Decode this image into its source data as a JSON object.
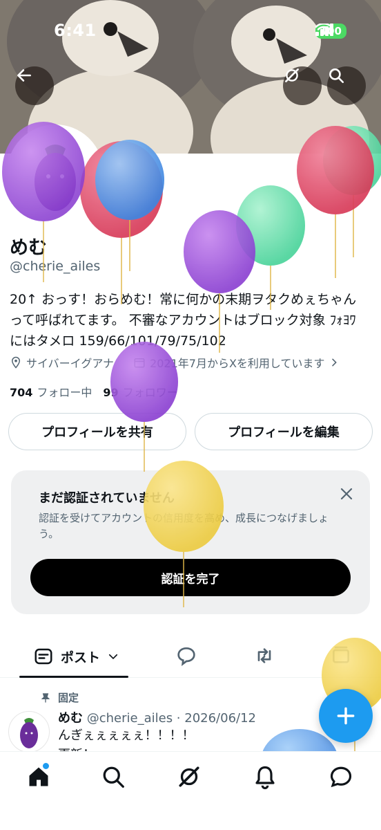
{
  "status_bar": {
    "time": "6:41",
    "battery": "100"
  },
  "header": {
    "back_icon": "arrow-left-icon",
    "grok_icon": "grok-icon",
    "search_icon": "search-icon"
  },
  "profile": {
    "display_name": "めむ",
    "handle": "@cherie_ailes",
    "bio_line1": "20↑ おっす！おらめむ！常に何かの末期ヲタクめぇちゃん",
    "bio_line2": "って呼ばれてます。 不審なアカウントはブロック対象 ﾌｫﾖﾜ",
    "bio_line3": "にはタメロ 159/66/101/79/75/102",
    "location": "サイバーイグアナ",
    "joined": "2021年7月からXを利用しています",
    "following_count": "704",
    "following_label": "フォロー中",
    "followers_count": "99",
    "followers_label": "フォロワー",
    "share_button": "プロフィールを共有",
    "edit_button": "プロフィールを編集"
  },
  "verify_card": {
    "title": "まだ認証されていません",
    "description": "認証を受けてアカウントの信用度を高め、成長につなげましょう。",
    "button": "認証を完了"
  },
  "tabs": {
    "active_label": "ポスト"
  },
  "pinned_post": {
    "pinned_label": "固定",
    "author": "めむ",
    "handle_date": "@cherie_ailes · 2026/06/12",
    "text_line1": "んぎぇぇぇぇぇ！！！！",
    "text_line2": "更新！"
  },
  "bottom_nav": [
    "home-icon",
    "search-icon",
    "grok-icon",
    "notifications-icon",
    "messages-icon"
  ],
  "colors": {
    "accent": "#1d9bf0",
    "text": "#0f1419",
    "secondary": "#536471"
  }
}
